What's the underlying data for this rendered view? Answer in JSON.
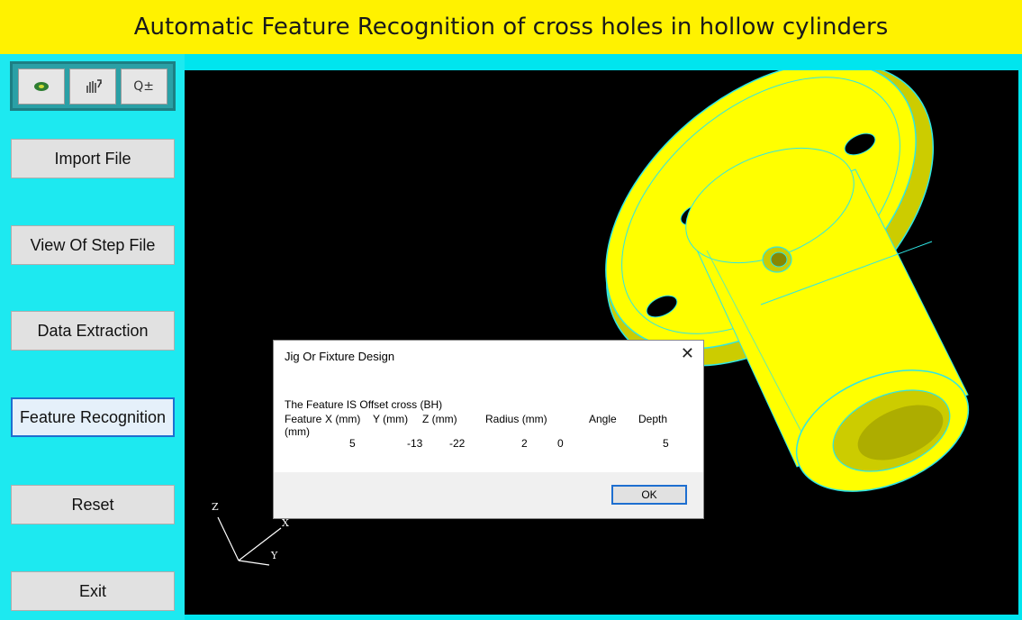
{
  "title": "Automatic Feature Recognition of cross holes in hollow cylinders",
  "toolbar": {
    "rotate_icon": "rotate-icon",
    "pan_icon": "pan-hand-icon",
    "zoom_icon": "zoom-in-icon",
    "zoom_label": "Q±"
  },
  "sidebar": {
    "import": "Import File",
    "view": "View Of Step File",
    "extract": "Data Extraction",
    "recognize": "Feature Recognition",
    "reset": "Reset",
    "exit": "Exit"
  },
  "axes": {
    "z": "Z",
    "x": "X",
    "y": "Y"
  },
  "dialog": {
    "title": "Jig Or Fixture Design",
    "close": "✕",
    "message": "The Feature IS  Offset cross (BH)",
    "headers": {
      "feature": "Feature",
      "feature_unit": "(mm)",
      "x": "X (mm)",
      "y": "Y (mm)",
      "z": "Z (mm)",
      "radius": "Radius (mm)",
      "angle": "Angle",
      "depth": "Depth"
    },
    "values": {
      "x": "5",
      "y": "-13",
      "z": "-22",
      "radius": "2",
      "angle": "0",
      "depth": "5"
    },
    "ok": "OK"
  },
  "colors": {
    "title_bg": "#fff200",
    "panel_bg": "#00e5ee",
    "model": "#ffff00",
    "edge": "#2ee6e6"
  }
}
